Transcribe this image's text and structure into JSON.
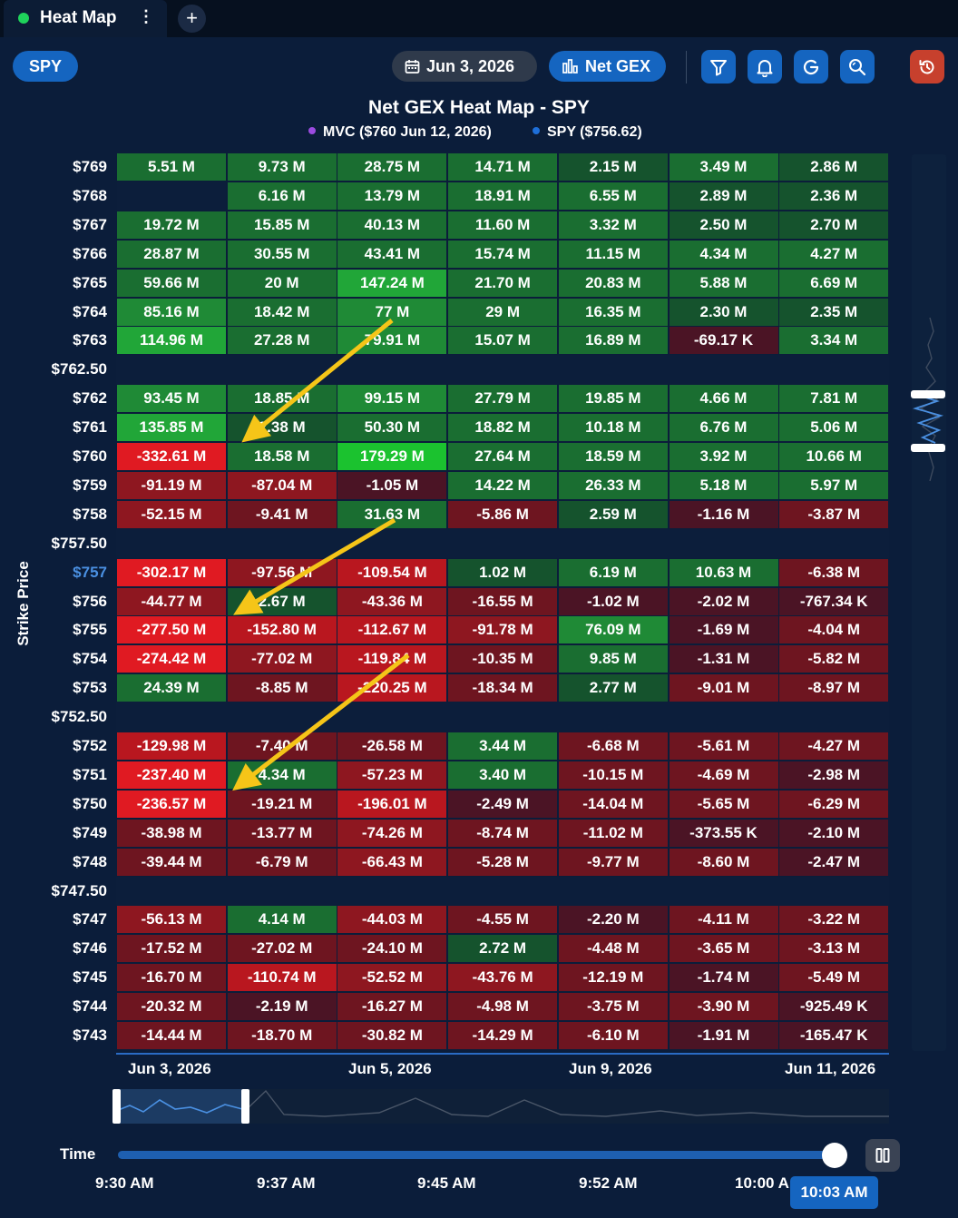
{
  "tab": {
    "title": "Heat Map",
    "more": "⋮",
    "add": "+"
  },
  "toolbar": {
    "symbol": "SPY",
    "date": "Jun 3, 2026",
    "metric": "Net GEX",
    "buttons": [
      "filter-icon",
      "bell-icon",
      "refresh-icon",
      "search-icon",
      "reset-icon"
    ]
  },
  "chart_data": {
    "type": "heatmap",
    "title": "Net GEX Heat Map - SPY",
    "legend": [
      {
        "label": "MVC ($760 Jun 12, 2026)",
        "color": "#9b4be0"
      },
      {
        "label": "SPY ($756.62)",
        "color": "#1e6fd9"
      }
    ],
    "ylabel": "Strike Price",
    "highlight_strike": "$757",
    "x_tick_labels": [
      "Jun 3, 2026",
      "Jun 5, 2026",
      "Jun 9, 2026",
      "Jun 11, 2026"
    ],
    "rows": [
      {
        "strike": "$769",
        "cells": [
          "5.51 M",
          "9.73 M",
          "28.75 M",
          "14.71 M",
          "2.15 M",
          "3.49 M",
          "2.86 M"
        ],
        "v": [
          5.51,
          9.73,
          28.75,
          14.71,
          2.15,
          3.49,
          2.86
        ]
      },
      {
        "strike": "$768",
        "cells": [
          "",
          "6.16 M",
          "13.79 M",
          "18.91 M",
          "6.55 M",
          "2.89 M",
          "2.36 M"
        ],
        "v": [
          null,
          6.16,
          13.79,
          18.91,
          6.55,
          2.89,
          2.36
        ]
      },
      {
        "strike": "$767",
        "cells": [
          "19.72 M",
          "15.85 M",
          "40.13 M",
          "11.60 M",
          "3.32 M",
          "2.50 M",
          "2.70 M"
        ],
        "v": [
          19.72,
          15.85,
          40.13,
          11.6,
          3.32,
          2.5,
          2.7
        ]
      },
      {
        "strike": "$766",
        "cells": [
          "28.87 M",
          "30.55 M",
          "43.41 M",
          "15.74 M",
          "11.15 M",
          "4.34 M",
          "4.27 M"
        ],
        "v": [
          28.87,
          30.55,
          43.41,
          15.74,
          11.15,
          4.34,
          4.27
        ]
      },
      {
        "strike": "$765",
        "cells": [
          "59.66 M",
          "20 M",
          "147.24 M",
          "21.70 M",
          "20.83 M",
          "5.88 M",
          "6.69 M"
        ],
        "v": [
          59.66,
          20,
          147.24,
          21.7,
          20.83,
          5.88,
          6.69
        ]
      },
      {
        "strike": "$764",
        "cells": [
          "85.16 M",
          "18.42 M",
          "77 M",
          "29 M",
          "16.35 M",
          "2.30 M",
          "2.35 M"
        ],
        "v": [
          85.16,
          18.42,
          77,
          29,
          16.35,
          2.3,
          2.35
        ]
      },
      {
        "strike": "$763",
        "cells": [
          "114.96 M",
          "27.28 M",
          "79.91 M",
          "15.07 M",
          "16.89 M",
          "-69.17 K",
          "3.34 M"
        ],
        "v": [
          114.96,
          27.28,
          79.91,
          15.07,
          16.89,
          -0.07,
          3.34
        ]
      },
      {
        "strike": "$762.50",
        "cells": [],
        "v": []
      },
      {
        "strike": "$762",
        "cells": [
          "93.45 M",
          "18.85 M",
          "99.15 M",
          "27.79 M",
          "19.85 M",
          "4.66 M",
          "7.81 M"
        ],
        "v": [
          93.45,
          18.85,
          99.15,
          27.79,
          19.85,
          4.66,
          7.81
        ]
      },
      {
        "strike": "$761",
        "cells": [
          "135.85 M",
          "2.38 M",
          "50.30 M",
          "18.82 M",
          "10.18 M",
          "6.76 M",
          "5.06 M"
        ],
        "v": [
          135.85,
          2.38,
          50.3,
          18.82,
          10.18,
          6.76,
          5.06
        ]
      },
      {
        "strike": "$760",
        "cells": [
          "-332.61 M",
          "18.58 M",
          "179.29 M",
          "27.64 M",
          "18.59 M",
          "3.92 M",
          "10.66 M"
        ],
        "v": [
          -332.61,
          18.58,
          179.29,
          27.64,
          18.59,
          3.92,
          10.66
        ]
      },
      {
        "strike": "$759",
        "cells": [
          "-91.19 M",
          "-87.04 M",
          "-1.05 M",
          "14.22 M",
          "26.33 M",
          "5.18 M",
          "5.97 M"
        ],
        "v": [
          -91.19,
          -87.04,
          -1.05,
          14.22,
          26.33,
          5.18,
          5.97
        ]
      },
      {
        "strike": "$758",
        "cells": [
          "-52.15 M",
          "-9.41 M",
          "31.63 M",
          "-5.86 M",
          "2.59 M",
          "-1.16 M",
          "-3.87 M"
        ],
        "v": [
          -52.15,
          -9.41,
          31.63,
          -5.86,
          2.59,
          -1.16,
          -3.87
        ]
      },
      {
        "strike": "$757.50",
        "cells": [],
        "v": []
      },
      {
        "strike": "$757",
        "cells": [
          "-302.17 M",
          "-97.56 M",
          "-109.54 M",
          "1.02 M",
          "6.19 M",
          "10.63 M",
          "-6.38 M"
        ],
        "v": [
          -302.17,
          -97.56,
          -109.54,
          1.02,
          6.19,
          10.63,
          -6.38
        ]
      },
      {
        "strike": "$756",
        "cells": [
          "-44.77 M",
          "2.67 M",
          "-43.36 M",
          "-16.55 M",
          "-1.02 M",
          "-2.02 M",
          "-767.34 K"
        ],
        "v": [
          -44.77,
          2.67,
          -43.36,
          -16.55,
          -1.02,
          -2.02,
          -0.77
        ]
      },
      {
        "strike": "$755",
        "cells": [
          "-277.50 M",
          "-152.80 M",
          "-112.67 M",
          "-91.78 M",
          "76.09 M",
          "-1.69 M",
          "-4.04 M"
        ],
        "v": [
          -277.5,
          -152.8,
          -112.67,
          -91.78,
          76.09,
          -1.69,
          -4.04
        ]
      },
      {
        "strike": "$754",
        "cells": [
          "-274.42 M",
          "-77.02 M",
          "-119.84 M",
          "-10.35 M",
          "9.85 M",
          "-1.31 M",
          "-5.82 M"
        ],
        "v": [
          -274.42,
          -77.02,
          -119.84,
          -10.35,
          9.85,
          -1.31,
          -5.82
        ]
      },
      {
        "strike": "$753",
        "cells": [
          "24.39 M",
          "-8.85 M",
          "-220.25 M",
          "-18.34 M",
          "2.77 M",
          "-9.01 M",
          "-8.97 M"
        ],
        "v": [
          24.39,
          -8.85,
          -220.25,
          -18.34,
          2.77,
          -9.01,
          -8.97
        ]
      },
      {
        "strike": "$752.50",
        "cells": [],
        "v": []
      },
      {
        "strike": "$752",
        "cells": [
          "-129.98 M",
          "-7.40 M",
          "-26.58 M",
          "3.44 M",
          "-6.68 M",
          "-5.61 M",
          "-4.27 M"
        ],
        "v": [
          -129.98,
          -7.4,
          -26.58,
          3.44,
          -6.68,
          -5.61,
          -4.27
        ]
      },
      {
        "strike": "$751",
        "cells": [
          "-237.40 M",
          "4.34 M",
          "-57.23 M",
          "3.40 M",
          "-10.15 M",
          "-4.69 M",
          "-2.98 M"
        ],
        "v": [
          -237.4,
          4.34,
          -57.23,
          3.4,
          -10.15,
          -4.69,
          -2.98
        ]
      },
      {
        "strike": "$750",
        "cells": [
          "-236.57 M",
          "-19.21 M",
          "-196.01 M",
          "-2.49 M",
          "-14.04 M",
          "-5.65 M",
          "-6.29 M"
        ],
        "v": [
          -236.57,
          -19.21,
          -196.01,
          -2.49,
          -14.04,
          -5.65,
          -6.29
        ]
      },
      {
        "strike": "$749",
        "cells": [
          "-38.98 M",
          "-13.77 M",
          "-74.26 M",
          "-8.74 M",
          "-11.02 M",
          "-373.55 K",
          "-2.10 M"
        ],
        "v": [
          -38.98,
          -13.77,
          -74.26,
          -8.74,
          -11.02,
          -0.37,
          -2.1
        ]
      },
      {
        "strike": "$748",
        "cells": [
          "-39.44 M",
          "-6.79 M",
          "-66.43 M",
          "-5.28 M",
          "-9.77 M",
          "-8.60 M",
          "-2.47 M"
        ],
        "v": [
          -39.44,
          -6.79,
          -66.43,
          -5.28,
          -9.77,
          -8.6,
          -2.47
        ]
      },
      {
        "strike": "$747.50",
        "cells": [],
        "v": []
      },
      {
        "strike": "$747",
        "cells": [
          "-56.13 M",
          "4.14 M",
          "-44.03 M",
          "-4.55 M",
          "-2.20 M",
          "-4.11 M",
          "-3.22 M"
        ],
        "v": [
          -56.13,
          4.14,
          -44.03,
          -4.55,
          -2.2,
          -4.11,
          -3.22
        ]
      },
      {
        "strike": "$746",
        "cells": [
          "-17.52 M",
          "-27.02 M",
          "-24.10 M",
          "2.72 M",
          "-4.48 M",
          "-3.65 M",
          "-3.13 M"
        ],
        "v": [
          -17.52,
          -27.02,
          -24.1,
          2.72,
          -4.48,
          -3.65,
          -3.13
        ]
      },
      {
        "strike": "$745",
        "cells": [
          "-16.70 M",
          "-110.74 M",
          "-52.52 M",
          "-43.76 M",
          "-12.19 M",
          "-1.74 M",
          "-5.49 M"
        ],
        "v": [
          -16.7,
          -110.74,
          -52.52,
          -43.76,
          -12.19,
          -1.74,
          -5.49
        ]
      },
      {
        "strike": "$744",
        "cells": [
          "-20.32 M",
          "-2.19 M",
          "-16.27 M",
          "-4.98 M",
          "-3.75 M",
          "-3.90 M",
          "-925.49 K"
        ],
        "v": [
          -20.32,
          -2.19,
          -16.27,
          -4.98,
          -3.75,
          -3.9,
          -0.93
        ]
      },
      {
        "strike": "$743",
        "cells": [
          "-14.44 M",
          "-18.70 M",
          "-30.82 M",
          "-14.29 M",
          "-6.10 M",
          "-1.91 M",
          "-165.47 K"
        ],
        "v": [
          -14.44,
          -18.7,
          -30.82,
          -14.29,
          -6.1,
          -1.91,
          -0.17
        ]
      }
    ]
  },
  "timeline": {
    "label": "Time",
    "ticks": [
      "9:30 AM",
      "9:37 AM",
      "9:45 AM",
      "9:52 AM",
      "10:00 A"
    ],
    "current": "10:03 AM",
    "progress": 1.0
  },
  "colors": {
    "positive": "#1e7a34",
    "negative": "#8b1a1f",
    "accent": "#1565c0",
    "annotation_arrow": "#f5c518"
  }
}
